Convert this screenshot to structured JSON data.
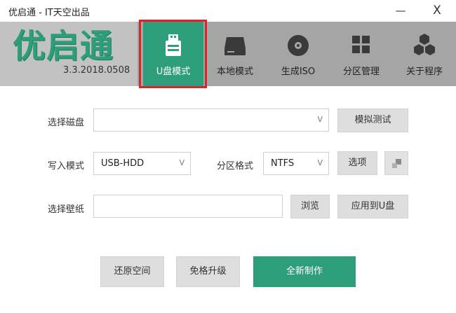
{
  "window": {
    "title": "优启通 - IT天空出品",
    "minimize": "—",
    "close": "X"
  },
  "brand": {
    "logo_text": "优启通",
    "version": "3.3.2018.0508"
  },
  "nav": {
    "active": "U盘模式",
    "items": [
      {
        "label": "U盘模式",
        "icon": "usb-drive-icon"
      },
      {
        "label": "本地模式",
        "icon": "hard-drive-icon"
      },
      {
        "label": "生成ISO",
        "icon": "disc-icon"
      },
      {
        "label": "分区管理",
        "icon": "partition-grid-icon"
      },
      {
        "label": "关于程序",
        "icon": "cubes-icon"
      }
    ]
  },
  "form": {
    "disk_label": "选择磁盘",
    "disk_value": "",
    "simulate_test": "模拟测试",
    "write_mode_label": "写入模式",
    "write_mode_value": "USB-HDD",
    "partition_format_label": "分区格式",
    "partition_format_value": "NTFS",
    "options": "选项",
    "wallpaper_label": "选择壁纸",
    "wallpaper_value": "",
    "browse": "浏览",
    "apply_to_usb": "应用到U盘",
    "dropdown_arrow": "V"
  },
  "actions": {
    "restore_space": "还原空间",
    "upgrade_no_format": "免格升级",
    "new_build": "全新制作"
  },
  "colors": {
    "accent": "#2e9e7a",
    "header_bg": "#a5a5a5",
    "brand_bg": "#c2c2c2",
    "highlight_frame": "#d6262a",
    "button_bg": "#dedede"
  }
}
